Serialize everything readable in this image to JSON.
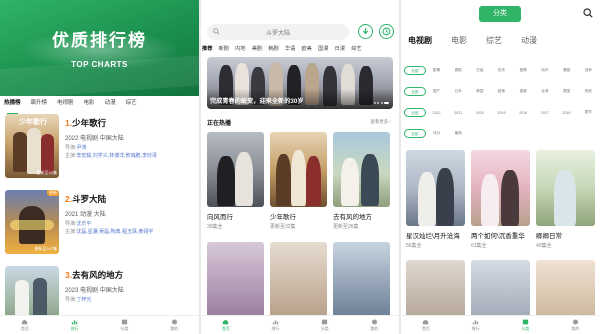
{
  "panel1": {
    "banner_title": "优质排行榜",
    "banner_sub": "TOP CHARTS",
    "tabs": [
      "热播榜",
      "飙升榜",
      "电视剧",
      "电影",
      "动漫",
      "综艺"
    ],
    "items": [
      {
        "num": "1.",
        "title": "少年歌行",
        "year": "2022",
        "genre": "电视剧",
        "region": "中国大陆",
        "dir_label": "导演:",
        "director": "尹涛",
        "cast_label": "主演:",
        "cast": "李宏毅,刘学义,林博洋,敖瑞鹏,李欣泽",
        "badge": "",
        "overlay": "更新至40集"
      },
      {
        "num": "2.",
        "title": "斗罗大陆",
        "year": "2021",
        "genre": "动漫",
        "region": "大陆",
        "dir_label": "导演:",
        "director": "沈乐平",
        "cast_label": "主演:",
        "cast": "沈磊,星骥,吴磊,陶典,程玉珠,黄翊宇",
        "badge": "更新",
        "overlay": "更新至247集"
      },
      {
        "num": "3.",
        "title": "去有风的地方",
        "year": "2023",
        "genre": "电视剧",
        "region": "中国大陆",
        "dir_label": "导演:",
        "director": "丁梓光",
        "cast_label": "",
        "cast": "",
        "badge": "",
        "overlay": ""
      }
    ]
  },
  "panel2": {
    "search_text": "斗罗大陆",
    "tabs": [
      "推荐",
      "新剧",
      "内地",
      "美剧",
      "韩剧",
      "华语",
      "欧美",
      "国漫",
      "日漫",
      "综艺"
    ],
    "hero_caption": "完成青春的蜕变，迎来全新的30岁",
    "section_title": "正在热播",
    "more_label": "查看更多",
    "cards": [
      {
        "title": "向风而行",
        "sub": "39集全"
      },
      {
        "title": "少年歌行",
        "sub": "更新至32集"
      },
      {
        "title": "去有风的地方",
        "sub": "更新至26集"
      }
    ]
  },
  "panel3": {
    "category_button": "分类",
    "tabs": [
      "电视剧",
      "电影",
      "综艺",
      "动漫"
    ],
    "filter_rows": [
      [
        "全部",
        "剧情",
        "喜剧",
        "古装",
        "历史",
        "爱情",
        "动作",
        "悬疑",
        "战争"
      ],
      [
        "全部",
        "国产",
        "日本",
        "韩国",
        "欧美",
        "香港",
        "台湾",
        "泰国",
        "其他"
      ],
      [
        "全部",
        "2022",
        "2021",
        "2020",
        "2019",
        "2018",
        "2017",
        "2016",
        "更早"
      ],
      [
        "全部",
        "评分",
        "最新",
        "",
        "",
        "",
        "",
        "",
        ""
      ]
    ],
    "cards": [
      {
        "title": "星汉灿烂\\月升沧海",
        "sub": "56集全"
      },
      {
        "title": "两个如何\\沉香重华",
        "sub": "63集全"
      },
      {
        "title": "卿卿日常",
        "sub": "40集全"
      }
    ]
  },
  "bottom_nav": [
    "首页",
    "排行",
    "分类",
    "我的"
  ]
}
